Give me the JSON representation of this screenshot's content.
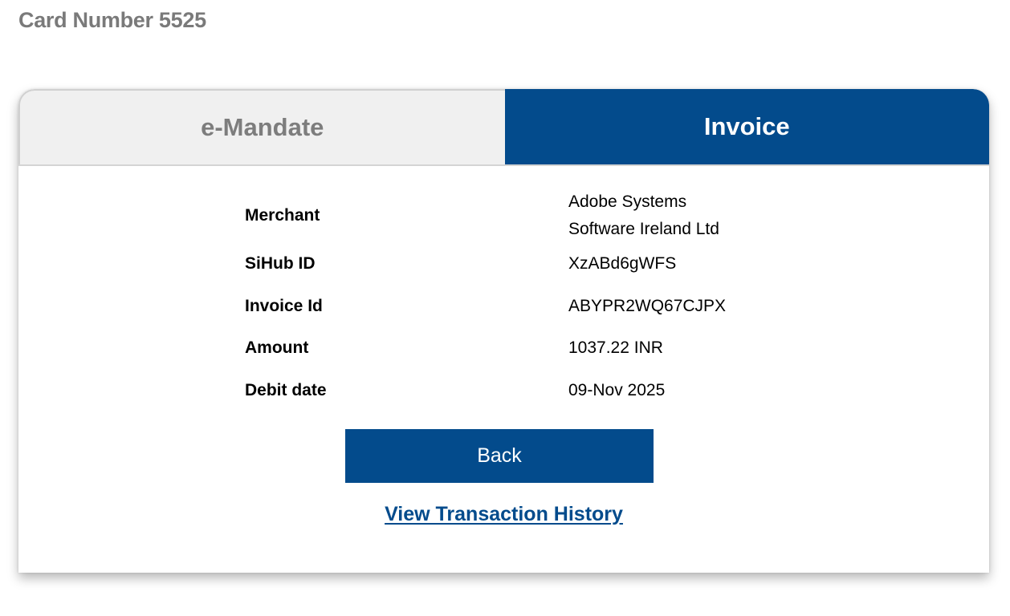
{
  "page": {
    "title": "Card Number 5525"
  },
  "tabs": [
    {
      "label": "e-Mandate",
      "active": false
    },
    {
      "label": "Invoice",
      "active": true
    }
  ],
  "details": {
    "merchant": {
      "label": "Merchant",
      "value_line1": "Adobe Systems",
      "value_line2": "Software Ireland Ltd"
    },
    "sihub_id": {
      "label": "SiHub ID",
      "value": "XzABd6gWFS"
    },
    "invoice_id": {
      "label": "Invoice Id",
      "value": "ABYPR2WQ67CJPX"
    },
    "amount": {
      "label": "Amount",
      "value": "1037.22 INR"
    },
    "debit_date": {
      "label": "Debit date",
      "value": "09-Nov 2025"
    }
  },
  "actions": {
    "back_label": "Back",
    "history_link": "View Transaction History"
  },
  "colors": {
    "primary": "#034b8c",
    "inactive_tab_bg": "#f0f0f0",
    "inactive_tab_text": "#7d7d7d",
    "title_text": "#7a7a7a"
  }
}
